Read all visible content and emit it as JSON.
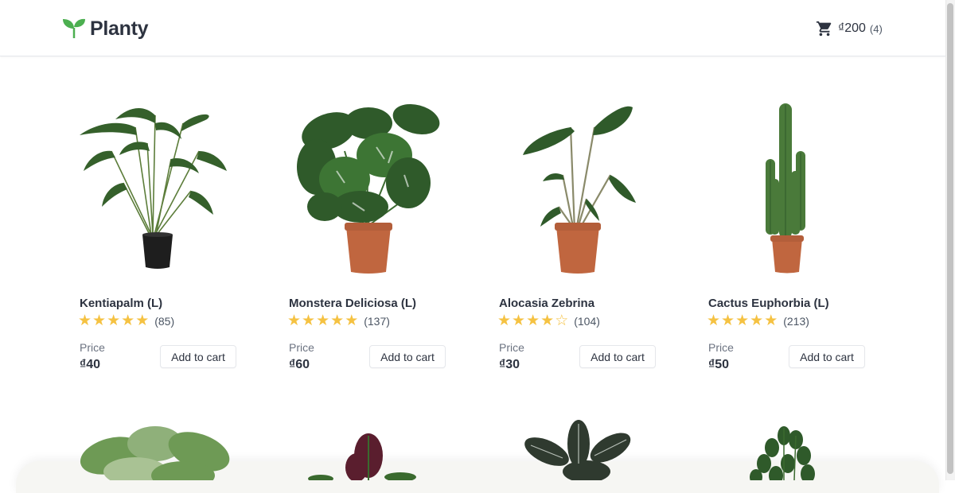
{
  "brand": {
    "name": "Planty",
    "logo_icon": "sprout-icon",
    "color": "#4caf50"
  },
  "cart": {
    "icon": "shopping-cart-icon",
    "total": "₫200",
    "count": "(4)"
  },
  "products": [
    {
      "name": "Kentiapalm (L)",
      "stars": 5,
      "reviews": "(85)",
      "price_label": "Price",
      "price": "₫40",
      "button": "Add to cart"
    },
    {
      "name": "Monstera Deliciosa (L)",
      "stars": 5,
      "reviews": "(137)",
      "price_label": "Price",
      "price": "₫60",
      "button": "Add to cart"
    },
    {
      "name": "Alocasia Zebrina",
      "stars": 4,
      "reviews": "(104)",
      "price_label": "Price",
      "price": "₫30",
      "button": "Add to cart"
    },
    {
      "name": "Cactus Euphorbia (L)",
      "stars": 5,
      "reviews": "(213)",
      "price_label": "Price",
      "price": "₫50",
      "button": "Add to cart"
    }
  ],
  "colors": {
    "star": "#f5c242",
    "text": "#2d3340",
    "leaf_dark": "#2f5a2a",
    "leaf": "#4a7a3a",
    "pot_terracotta": "#c0663f",
    "pot_black": "#1e1e1e"
  }
}
